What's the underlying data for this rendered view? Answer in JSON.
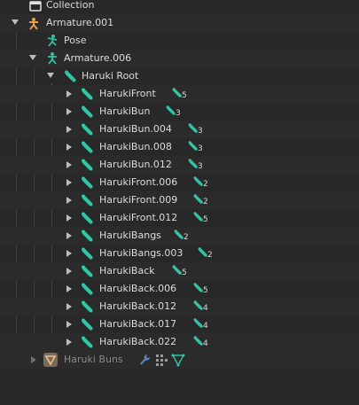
{
  "outliner": {
    "collection": {
      "label": "Collection",
      "icon": "collection-icon"
    },
    "armature": {
      "label": "Armature.001",
      "icon": "armature-object-icon"
    },
    "pose": {
      "label": "Pose",
      "icon": "pose-icon"
    },
    "armature_data": {
      "label": "Armature.006",
      "icon": "armature-data-icon"
    },
    "root_bone": {
      "label": "Haruki Root",
      "icon": "bone-icon"
    },
    "bones": [
      {
        "label": "HarukiFront",
        "count": "5"
      },
      {
        "label": "HarukiBun",
        "count": "3"
      },
      {
        "label": "HarukiBun.004",
        "count": "3"
      },
      {
        "label": "HarukiBun.008",
        "count": "3"
      },
      {
        "label": "HarukiBun.012",
        "count": "3"
      },
      {
        "label": "HarukiFront.006",
        "count": "2"
      },
      {
        "label": "HarukiFront.009",
        "count": "2"
      },
      {
        "label": "HarukiFront.012",
        "count": "5"
      },
      {
        "label": "HarukiBangs",
        "count": "2"
      },
      {
        "label": "HarukiBangs.003",
        "count": "2"
      },
      {
        "label": "HarukiBack",
        "count": "5"
      },
      {
        "label": "HarukiBack.006",
        "count": "5"
      },
      {
        "label": "HarukiBack.012",
        "count": "4"
      },
      {
        "label": "HarukiBack.017",
        "count": "4"
      },
      {
        "label": "HarukiBack.022",
        "count": "4"
      }
    ],
    "mesh": {
      "label": "Haruki Buns",
      "icon": "mesh-object-icon",
      "extras": [
        "wrench-icon",
        "vertex-groups-icon",
        "mesh-data-icon"
      ]
    },
    "colors": {
      "bone": "#2fc5a6",
      "armature": "#e8a04a",
      "text": "#dcdcdc",
      "dim_text": "#8a8a8a"
    }
  }
}
